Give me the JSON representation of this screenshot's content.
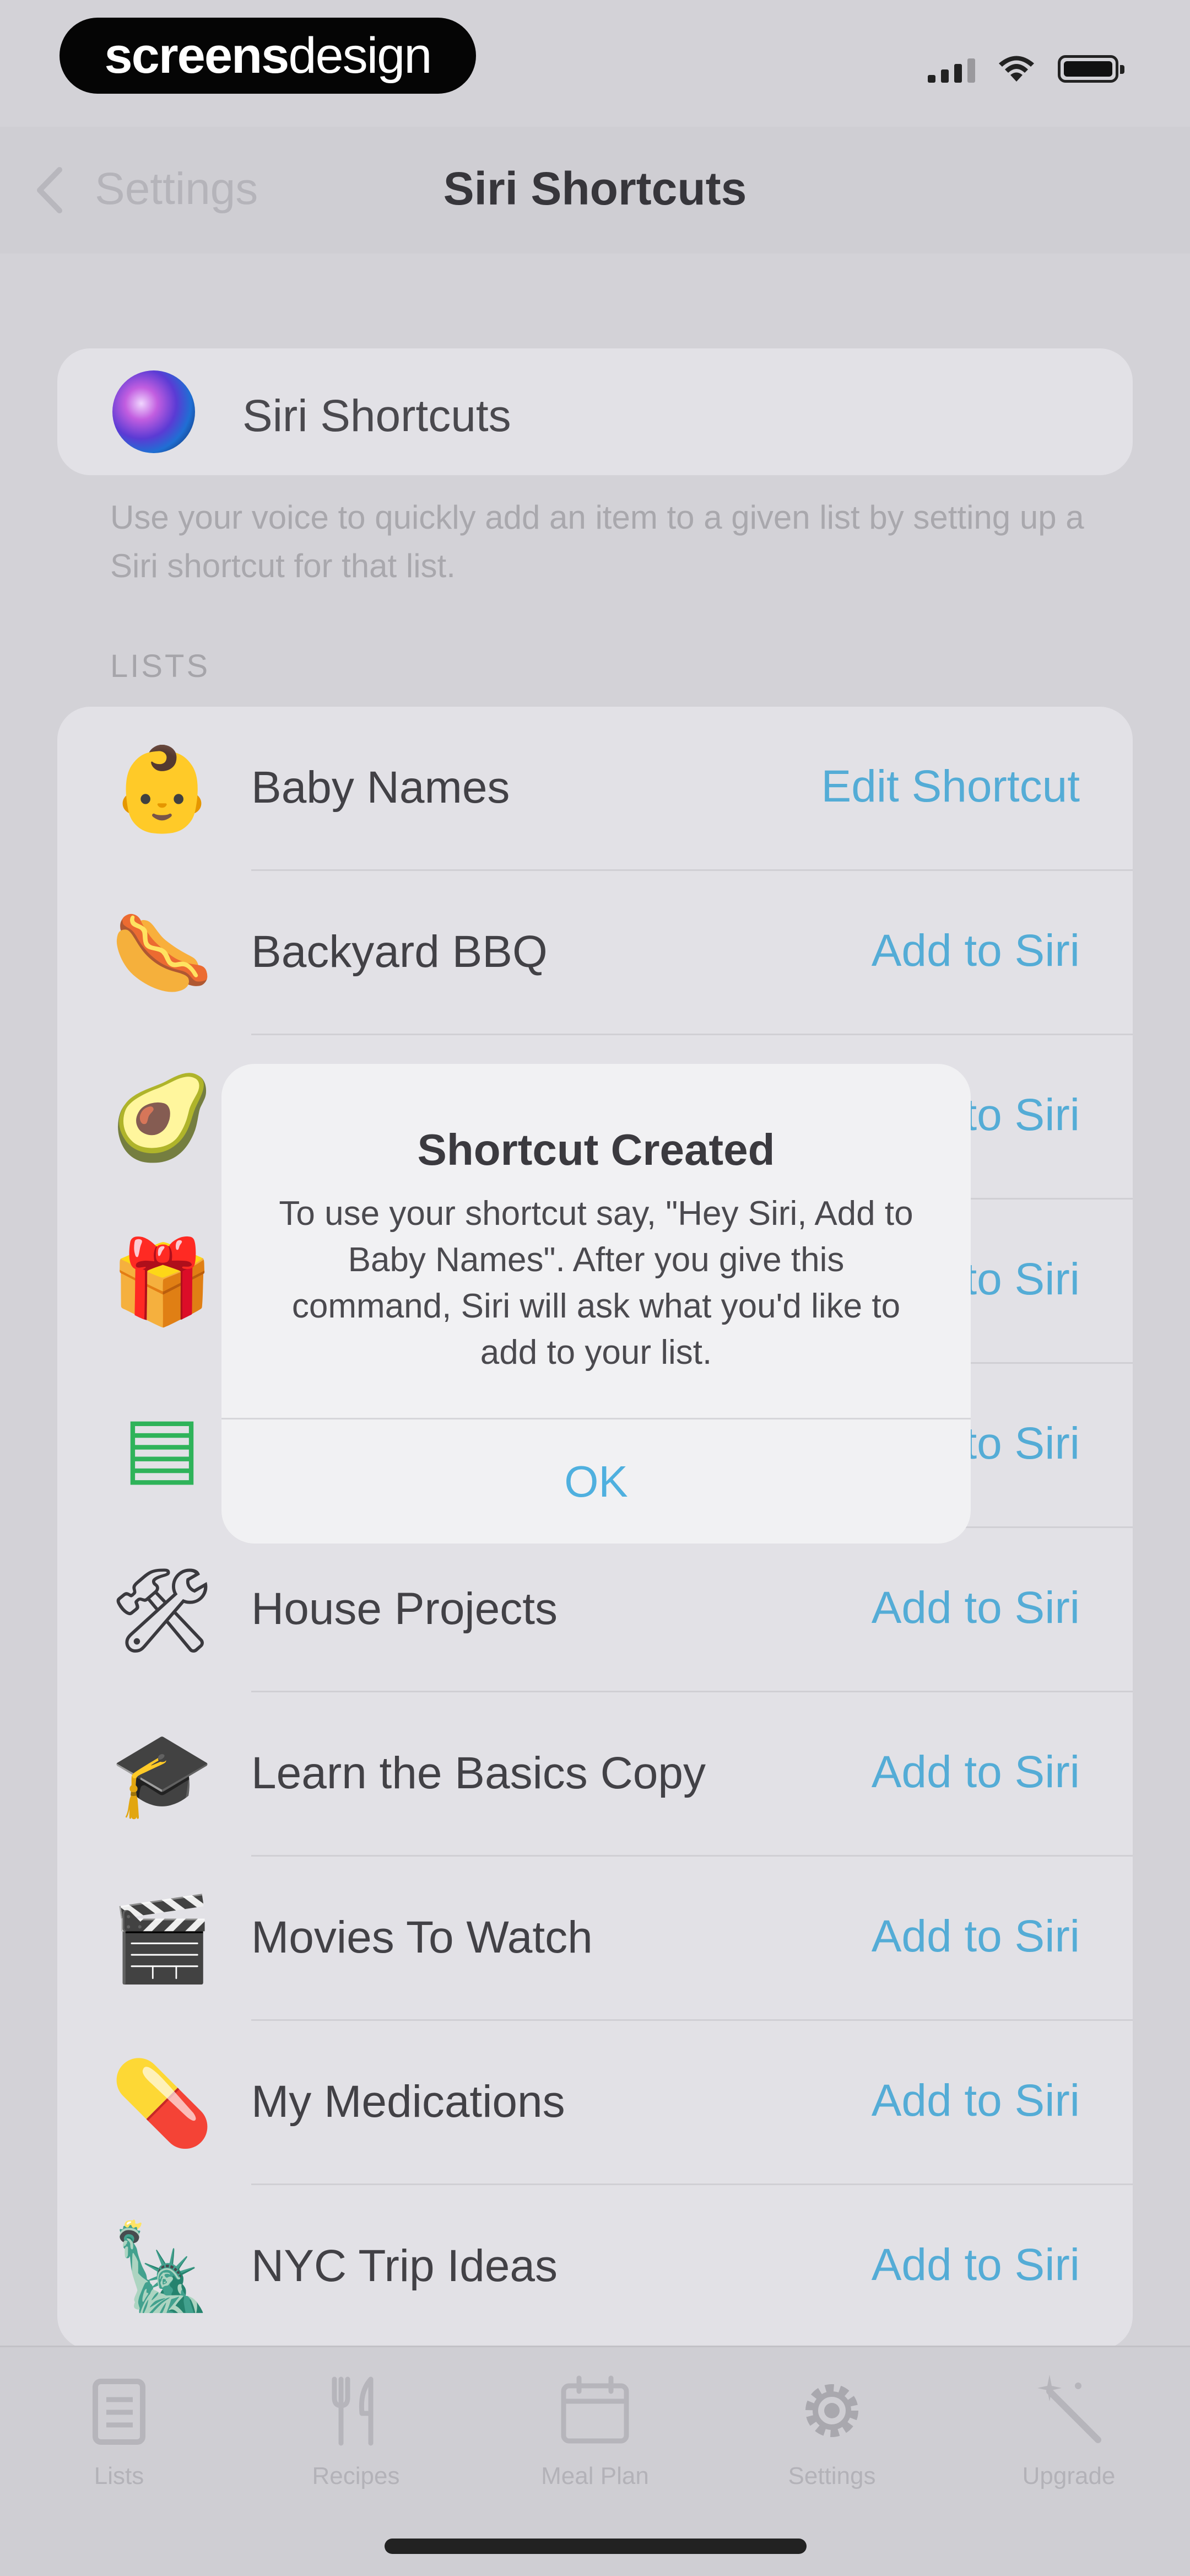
{
  "status_bar": {
    "brand": "screensdesign",
    "brand_bold": "screens",
    "brand_thin": "design"
  },
  "nav": {
    "back_label": "Settings",
    "title": "Siri Shortcuts"
  },
  "siri_card": {
    "label": "Siri Shortcuts",
    "icon": "siri-orb-icon"
  },
  "footnote": "Use your voice to quickly add an item to a given list by setting up a Siri shortcut for that list.",
  "section_header": "LISTS",
  "lists": [
    {
      "label": "Baby Names",
      "action": "Edit Shortcut",
      "icon": "baby-icon",
      "glyph": "👶"
    },
    {
      "label": "Backyard BBQ",
      "action": "Add to Siri",
      "icon": "hotdog-icon",
      "glyph": "🌭"
    },
    {
      "label": "",
      "action": "Add to Siri",
      "icon": "avocado-icon",
      "glyph": "🥑"
    },
    {
      "label": "",
      "action": "Add to Siri",
      "icon": "gift-icon",
      "glyph": "🎁"
    },
    {
      "label": "",
      "action": "Add to Siri",
      "icon": "spreadsheet-icon",
      "glyph": "▤"
    },
    {
      "label": "House Projects",
      "action": "Add to Siri",
      "icon": "hammer-wrench-icon",
      "glyph": "🛠"
    },
    {
      "label": "Learn the Basics Copy",
      "action": "Add to Siri",
      "icon": "graduation-cap-icon",
      "glyph": "🎓"
    },
    {
      "label": "Movies To Watch",
      "action": "Add to Siri",
      "icon": "clapper-board-icon",
      "glyph": "🎬"
    },
    {
      "label": "My Medications",
      "action": "Add to Siri",
      "icon": "pill-icon",
      "glyph": "💊"
    },
    {
      "label": "NYC Trip Ideas",
      "action": "Add to Siri",
      "icon": "statue-of-liberty-icon",
      "glyph": "🗽"
    }
  ],
  "alert": {
    "title": "Shortcut Created",
    "message": "To use your shortcut say, \"Hey Siri, Add to Baby Names\". After you give this command, Siri will ask what you'd like to add to your list.",
    "button": "OK"
  },
  "tabs": [
    {
      "label": "Lists",
      "icon": "lists-icon"
    },
    {
      "label": "Recipes",
      "icon": "fork-knife-icon"
    },
    {
      "label": "Meal Plan",
      "icon": "calendar-icon"
    },
    {
      "label": "Settings",
      "icon": "gear-icon"
    },
    {
      "label": "Upgrade",
      "icon": "magic-wand-icon"
    }
  ],
  "colors": {
    "accent": "#54acd6",
    "background": "#d3d2d7",
    "card": "#e2e1e6",
    "alert": "#f1f1f3"
  }
}
